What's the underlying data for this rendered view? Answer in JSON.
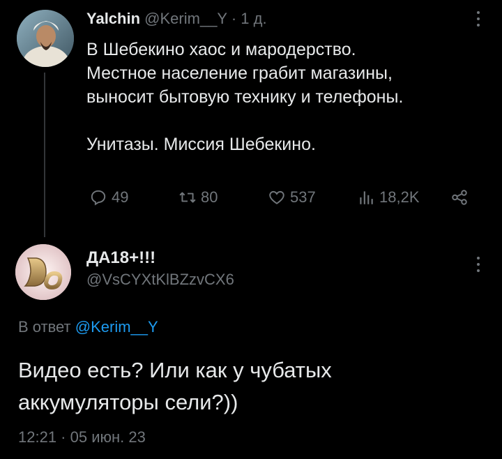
{
  "tweet1": {
    "display_name": "Yalchin",
    "handle": "@Kerim__Y",
    "separator": "·",
    "time_ago": "1 д.",
    "lines": [
      "В Шебекино хаос и мародерство.",
      "Местное население грабит магазины,",
      "выносит бытовую технику и телефоны.",
      "Унитазы. Миссия Шебекино."
    ],
    "stats": {
      "replies": "49",
      "retweets": "80",
      "likes": "537",
      "views": "18,2K"
    }
  },
  "tweet2": {
    "display_name": "ДА18+!!!",
    "handle": "@VsCYXtKlBZzvCX6",
    "reply_prefix": "В ответ",
    "reply_handle": "@Kerim__Y",
    "lines": [
      "Видео есть? Или как у чубатых",
      "аккумуляторы сели?))"
    ],
    "timestamp": "12:21 · 05 июн. 23"
  },
  "colors": {
    "background": "#000000",
    "text": "#e7e9ea",
    "muted": "#71767b",
    "link": "#1d9bf0"
  },
  "icons": [
    "reply-icon",
    "retweet-icon",
    "like-icon",
    "views-icon",
    "share-icon",
    "more-icon"
  ]
}
